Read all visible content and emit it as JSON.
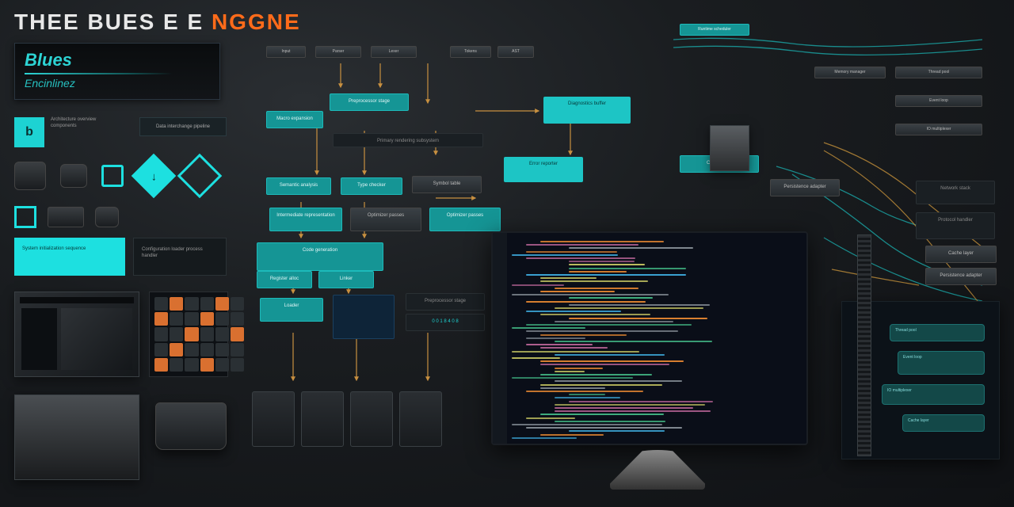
{
  "header": {
    "title_part1": "THEE BUES E E",
    "title_part2": "NGGNE"
  },
  "logo": {
    "brand": "Blues",
    "subtitle": "Encinlinez"
  },
  "legend": {
    "chip": "b",
    "text1": "Architecture overview components",
    "pill_label": "Data interchange pipeline"
  },
  "panels": {
    "cyan1": "System initialization sequence",
    "dark1": "Configuration loader process handler",
    "cyan_long": "Primary rendering subsystem"
  },
  "flow": {
    "top": [
      "Input",
      "Parser",
      "Lexer",
      "Tokens",
      "AST"
    ],
    "r1": [
      "Preprocessor stage",
      "Macro expansion"
    ],
    "r2": [
      "Semantic analysis",
      "Type checker",
      "Symbol table"
    ],
    "r3": [
      "Intermediate representation",
      "Optimizer passes"
    ],
    "r4": [
      "Code generation",
      "Register alloc"
    ],
    "r5": [
      "Linker",
      "Loader"
    ],
    "side": [
      "Diagnostics buffer",
      "Error reporter"
    ],
    "right_top": [
      "Runtime scheduler",
      "Memory manager"
    ],
    "right_mid": [
      "Thread pool",
      "Event loop",
      "IO multiplexer"
    ],
    "right_low": [
      "Cache layer",
      "Persistence adapter",
      "Network stack",
      "Protocol handler"
    ],
    "code_box": "0 0 1 8 4 0 8"
  },
  "colors": {
    "accent_cyan": "#1de0e0",
    "accent_orange": "#ff6b1a",
    "node_teal": "#159595"
  }
}
